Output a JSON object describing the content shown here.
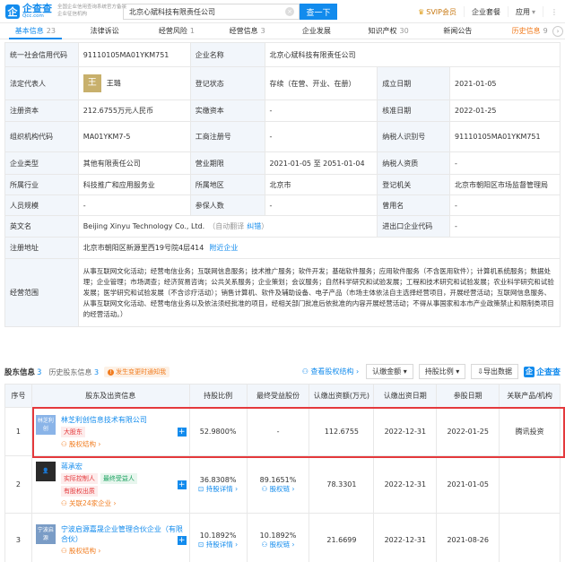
{
  "header": {
    "logo_char": "企",
    "logo_name": "企查查",
    "logo_domain": "Qcc.com",
    "slogan": "全国企业信用查询系统官方备案企业征信机构",
    "search_value": "北京心斌科技有限责任公司",
    "search_button": "查一下",
    "svip": "SVIP会员",
    "suite": "企业套餐",
    "apps": "应用",
    "more": "⋮"
  },
  "tabs": [
    {
      "label": "基本信息",
      "count": "23"
    },
    {
      "label": "法律诉讼",
      "count": ""
    },
    {
      "label": "经营风险",
      "count": "1"
    },
    {
      "label": "经营信息",
      "count": "3"
    },
    {
      "label": "企业发展",
      "count": ""
    },
    {
      "label": "知识产权",
      "count": "30"
    },
    {
      "label": "新闻公告",
      "count": ""
    },
    {
      "label": "历史信息",
      "count": "9"
    }
  ],
  "info": {
    "credit_code_label": "统一社会信用代码",
    "credit_code": "91110105MA01YKM751",
    "company_name_label": "企业名称",
    "company_name": "北京心斌科技有限责任公司",
    "legal_rep_label": "法定代表人",
    "legal_rep_avatar": "王",
    "legal_rep": "王璐",
    "reg_status_label": "登记状态",
    "reg_status": "存续（在营、开业、在册）",
    "found_date_label": "成立日期",
    "found_date": "2021-01-05",
    "reg_capital_label": "注册资本",
    "reg_capital": "212.6755万元人民币",
    "paid_capital_label": "实缴资本",
    "paid_capital": "-",
    "approve_date_label": "核准日期",
    "approve_date": "2022-01-25",
    "org_code_label": "组织机构代码",
    "org_code": "MA01YKM7-5",
    "biz_reg_label": "工商注册号",
    "biz_reg": "-",
    "taxpayer_id_label": "纳税人识别号",
    "taxpayer_id": "91110105MA01YKM751",
    "company_type_label": "企业类型",
    "company_type": "其他有限责任公司",
    "biz_term_label": "营业期限",
    "biz_term": "2021-01-05 至 2051-01-04",
    "taxpayer_qual_label": "纳税人资质",
    "taxpayer_qual": "-",
    "industry_label": "所属行业",
    "industry": "科技推广和应用服务业",
    "region_label": "所属地区",
    "region": "北京市",
    "reg_authority_label": "登记机关",
    "reg_authority": "北京市朝阳区市场监督管理局",
    "staff_label": "人员规模",
    "staff": "-",
    "insured_label": "参保人数",
    "insured": "-",
    "former_name_label": "曾用名",
    "former_name": "-",
    "english_label": "英文名",
    "english": "Beijing Xinyu Technology Co., Ltd.",
    "english_note": "（自动翻译",
    "english_fix": "纠错",
    "english_close": "）",
    "import_export_label": "进出口企业代码",
    "import_export": "-",
    "address_label": "注册地址",
    "address": "北京市朝阳区新源里西19号院4层414",
    "nearby": "附近企业",
    "scope_label": "经营范围",
    "scope": "从事互联网文化活动；经营电信业务；互联网信息服务；技术推广服务；软件开发；基础软件服务；应用软件服务（不含医用软件）；计算机系统服务；数据处理；企业管理；市场调查；经济贸易咨询；公共关系服务；企业策划；会议服务；自然科学研究和试验发展；工程和技术研究和试验发展；农业科学研究和试验发展；医学研究和试验发展（不含诊疗活动）；销售计算机、软件及辅助设备、电子产品（市场主体依法自主选择经营项目，开展经营活动；互联网信息服务、从事互联网文化活动、经营电信业务以及依法须经批准的项目，经相关部门批准后依批准的内容开展经营活动；不得从事国家和本市产业政策禁止和限制类项目的经营活动。）"
  },
  "shareholders": {
    "title": "股东信息",
    "count": "3",
    "history": "历史股东信息",
    "history_count": "3",
    "warn_icon": "!",
    "warn": "发生变更时通知我",
    "tool_structure": "查看股权结构 ›",
    "tool_amount": "认缴金额 ▾",
    "tool_ratio": "持股比例 ▾",
    "tool_export": "导出数据",
    "brand": "企查查",
    "columns": [
      "序号",
      "股东及出资信息",
      "持股比例",
      "最终受益股份",
      "认缴出资额(万元)",
      "认缴出资日期",
      "参股日期",
      "关联产品/机构"
    ],
    "rows": [
      {
        "no": "1",
        "logo": "林芝利创",
        "name": "林芝利创信息技术有限公司",
        "tags": [
          "大股东"
        ],
        "tag_colors": [
          "red"
        ],
        "link": "股权结构 ›",
        "ratio": "52.9800%",
        "ratio_link": "",
        "benefit": "-",
        "benefit_link": "",
        "amount": "112.6755",
        "sub_date": "2022-12-31",
        "join_date": "2022-01-25",
        "product": "腾讯投资"
      },
      {
        "no": "2",
        "logo": "",
        "name": "蒋承宏",
        "tags": [
          "实际控制人",
          "最终受益人",
          "有股权出质"
        ],
        "tag_colors": [
          "red",
          "green",
          "red"
        ],
        "link": "关联24家企业 ›",
        "ratio": "36.8308%",
        "ratio_link": "持股详情 ›",
        "benefit": "89.1651%",
        "benefit_link": "股权链 ›",
        "amount": "78.3301",
        "sub_date": "2022-12-31",
        "join_date": "2021-01-05",
        "product": ""
      },
      {
        "no": "3",
        "logo": "宁波启源",
        "name": "宁波启源嘉晟企业管理合伙企业（有限合伙）",
        "tags": [],
        "tag_colors": [],
        "link": "股权结构 ›",
        "ratio": "10.1892%",
        "ratio_link": "持股详情 ›",
        "benefit": "10.1892%",
        "benefit_link": "股权链 ›",
        "amount": "21.6699",
        "sub_date": "2022-12-31",
        "join_date": "2021-08-26",
        "product": ""
      }
    ]
  }
}
